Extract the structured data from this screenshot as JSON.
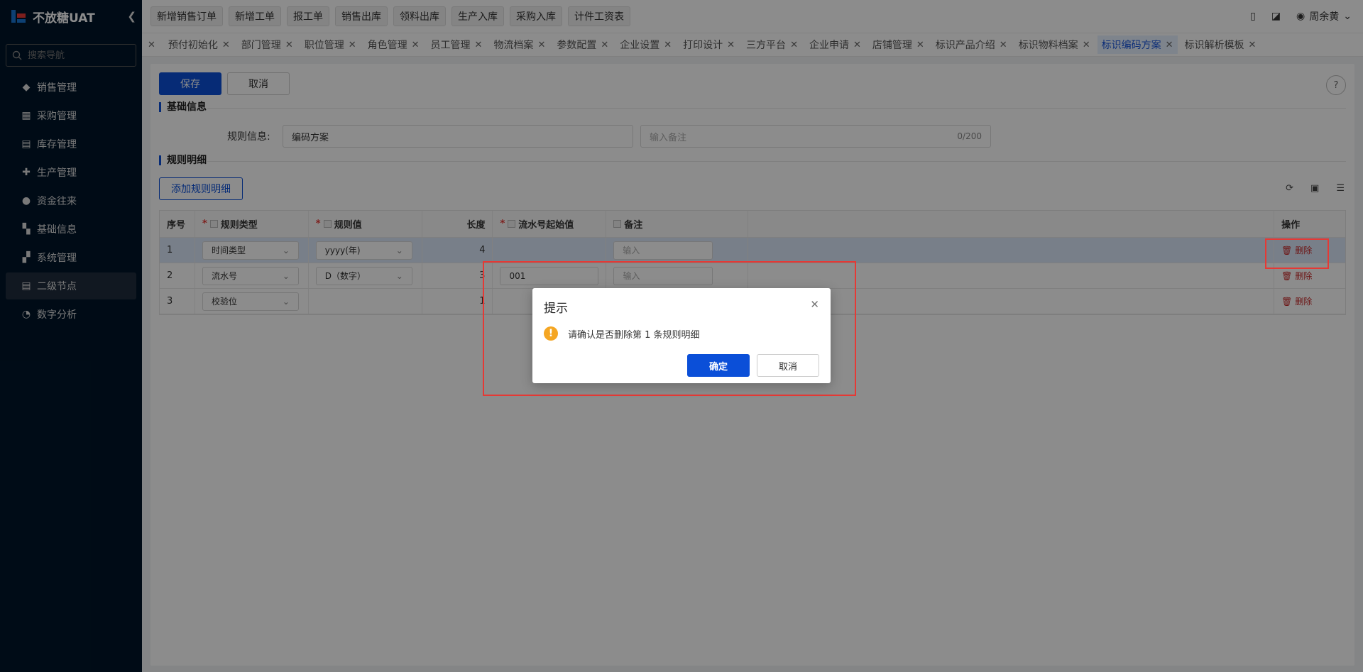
{
  "app": {
    "title": "不放糖UAT"
  },
  "sidebar": {
    "search_placeholder": "搜索导航",
    "items": [
      {
        "label": "销售管理",
        "icon": "tag-icon"
      },
      {
        "label": "采购管理",
        "icon": "cart-icon"
      },
      {
        "label": "库存管理",
        "icon": "warehouse-icon"
      },
      {
        "label": "生产管理",
        "icon": "production-icon"
      },
      {
        "label": "资金往来",
        "icon": "money-icon"
      },
      {
        "label": "基础信息",
        "icon": "grid-icon"
      },
      {
        "label": "系统管理",
        "icon": "system-icon"
      },
      {
        "label": "二级节点",
        "icon": "document-icon"
      },
      {
        "label": "数字分析",
        "icon": "pie-chart-icon"
      }
    ]
  },
  "topbar": {
    "quick": [
      "新增销售订单",
      "新增工单",
      "报工单",
      "销售出库",
      "领料出库",
      "生产入库",
      "采购入库",
      "计件工资表"
    ],
    "user": "周余黄"
  },
  "tabs": [
    "预付初始化",
    "部门管理",
    "职位管理",
    "角色管理",
    "员工管理",
    "物流档案",
    "参数配置",
    "企业设置",
    "打印设计",
    "三方平台",
    "企业申请",
    "店铺管理",
    "标识产品介绍",
    "标识物料档案",
    "标识编码方案",
    "标识解析模板"
  ],
  "active_tab_index": 14,
  "toolbar": {
    "save": "保存",
    "cancel": "取消",
    "help": "?"
  },
  "basic": {
    "title": "基础信息",
    "rule_label": "规则信息:",
    "rule_value": "编码方案",
    "remark_placeholder": "输入备注",
    "remark_counter": "0/200"
  },
  "detail": {
    "title": "规则明细",
    "add_button": "添加规则明细"
  },
  "table": {
    "headers": [
      "序号",
      "规则类型",
      "规则值",
      "长度",
      "流水号起始值",
      "备注",
      "",
      "操作"
    ],
    "input_placeholder": "输入",
    "delete_label": "删除",
    "rows": [
      {
        "index": "1",
        "type": "时间类型",
        "value": "yyyy(年)",
        "length": "4",
        "serial": ""
      },
      {
        "index": "2",
        "type": "流水号",
        "value": "D（数字）",
        "length": "3",
        "serial": "001"
      },
      {
        "index": "3",
        "type": "校验位",
        "value": "",
        "length": "1",
        "serial": ""
      }
    ]
  },
  "dialog": {
    "title": "提示",
    "message": "请确认是否删除第 1 条规则明细",
    "ok": "确定",
    "cancel": "取消"
  },
  "colors": {
    "primary": "#0b4fd8",
    "sidebar": "#001529",
    "danger": "#e53935",
    "warning": "#f5a623"
  }
}
